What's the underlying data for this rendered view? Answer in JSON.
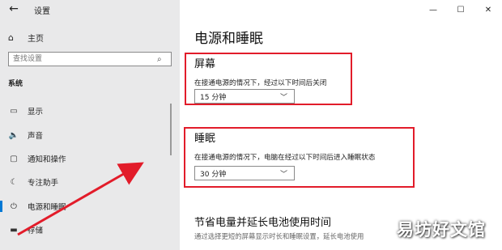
{
  "window": {
    "title": "设置",
    "back_icon": "←",
    "controls": {
      "minimize": "—",
      "maximize": "☐",
      "close": "✕"
    }
  },
  "sidebar": {
    "home_label": "主页",
    "home_icon": "⌂",
    "search_placeholder": "查找设置",
    "search_icon": "⌕",
    "section_title": "系统",
    "items": [
      {
        "label": "显示",
        "icon": "▭"
      },
      {
        "label": "声音",
        "icon": "🔈"
      },
      {
        "label": "通知和操作",
        "icon": "▢"
      },
      {
        "label": "专注助手",
        "icon": "☾"
      },
      {
        "label": "电源和睡眠",
        "icon": "⏻",
        "active": true
      },
      {
        "label": "存储",
        "icon": "▬"
      }
    ]
  },
  "main": {
    "page_title": "电源和睡眠",
    "screen": {
      "heading": "屏幕",
      "desc": "在接通电源的情况下，经过以下时间后关闭",
      "value": "15 分钟"
    },
    "sleep": {
      "heading": "睡眠",
      "desc": "在接通电源的情况下，电脑在经过以下时间后进入睡眠状态",
      "value": "30 分钟"
    },
    "battery": {
      "heading": "节省电量并延长电池使用时间",
      "desc": "通过选择更短的屏幕显示时长和睡眠设置，延长电池使用"
    }
  },
  "watermark": "易坊好文馆",
  "colors": {
    "highlight": "#e21c2a",
    "arrow": "#e21c2a",
    "accent": "#0078d4"
  }
}
